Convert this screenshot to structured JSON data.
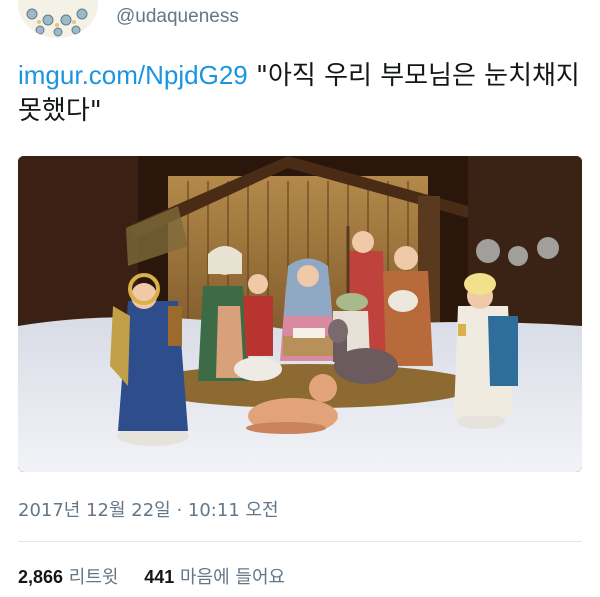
{
  "author": {
    "handle": "@udaqueness",
    "avatar_icon": "avatar-pattern-icon"
  },
  "tweet": {
    "link_text": "imgur.com/NpjdG29",
    "body_text": " \"아직 우리 부모님은 눈치채지 못했다\"",
    "timestamp": "2017년 12월 22일 · 10:11 오전"
  },
  "stats": {
    "retweets_count": "2,866",
    "retweets_label": "리트윗",
    "likes_count": "441",
    "likes_label": "마음에 들어요"
  },
  "colors": {
    "link": "#1b95e0",
    "secondary_text": "#657786",
    "primary_text": "#14171a",
    "divider": "#e1e8ed"
  }
}
